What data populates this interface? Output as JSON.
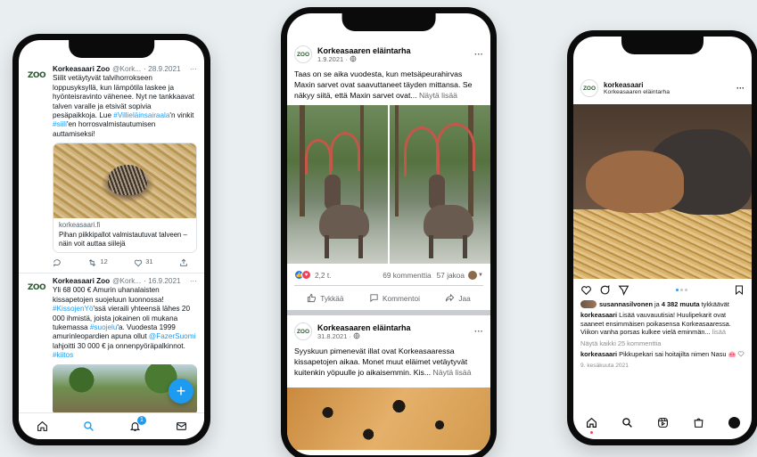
{
  "colors": {
    "background": "#e9eef1",
    "twitter_blue": "#1d9bf0",
    "facebook_gray": "#65676b",
    "instagram_blue": "#3897f0",
    "phone_frame": "#0b0b0b"
  },
  "logo_text": "ZOO",
  "twitter": {
    "tweets": [
      {
        "name": "Korkeasaari Zoo",
        "handle": "@Kork...",
        "date": "· 28.9.2021",
        "more": "···",
        "text_parts": [
          {
            "t": "Siilit vetäytyvät talvihorrokseen loppusyksyllä, kun lämpötila laskee ja hyönteisravinto vähenee. Nyt ne tankkaavat talven varalle ja etsivät sopivia pesäpaikkoja. Lue ",
            "tag": false
          },
          {
            "t": "#Villieläinsairaala",
            "tag": true
          },
          {
            "t": "'n vinkit ",
            "tag": false
          },
          {
            "t": "#siili",
            "tag": true
          },
          {
            "t": "'en horrosvalmistautumisen auttamiseksi!",
            "tag": false
          }
        ],
        "card": {
          "domain": "korkeasaari.fi",
          "title": "Pihan piikkipallot valmistautuvat talveen – näin voit auttaa siilejä"
        },
        "actions": {
          "reply": "",
          "retweets": "12",
          "likes": "31"
        }
      },
      {
        "name": "Korkeasaari Zoo",
        "handle": "@Kork...",
        "date": "· 16.9.2021",
        "more": "···",
        "text_parts": [
          {
            "t": "Yli 68 000 € Amurin uhanalaisten kissapetojen suojeluun luonnossa! ",
            "tag": false
          },
          {
            "t": "#KissojenYö",
            "tag": true
          },
          {
            "t": "'ssä vieraili yhteensä lähes 20 000 ihmistä, joista jokainen oli mukana tukemassa ",
            "tag": false
          },
          {
            "t": "#suojelu",
            "tag": true
          },
          {
            "t": "'a. Vuodesta 1999 amurinleopardien apuna ollut ",
            "tag": false
          },
          {
            "t": "@FazerSuomi",
            "tag": true
          },
          {
            "t": " lahjoitti 30 000 € ja onnenpyöräpalkinnot. ",
            "tag": false
          },
          {
            "t": "#kiitos",
            "tag": true
          }
        ]
      }
    ],
    "fab_label": "+",
    "notif_count": "1",
    "tabs": [
      "home-icon",
      "search-icon",
      "bell-icon",
      "mail-icon"
    ]
  },
  "facebook": {
    "post1": {
      "page": "Korkeasaaren eläintarha",
      "date": "1.9.2021 ·",
      "more": "···",
      "text": "Taas on se aika vuodesta, kun metsäpeurahirvas Maxin sarvet ovat saavuttaneet täyden mittansa. Se näkyy siitä, että Maxin sarvet ovat...",
      "see_more": "Näytä lisää",
      "reactions_count": "2,2 t.",
      "comments": "69 kommenttia",
      "shares": "57 jakoa",
      "actions": {
        "like": "Tykkää",
        "comment": "Kommentoi",
        "share": "Jaa"
      }
    },
    "post2": {
      "page": "Korkeasaaren eläintarha",
      "date": "31.8.2021 ·",
      "more": "···",
      "text": "Syyskuun pimenevät illat ovat Korkeasaaressa kissapetojen aikaa. Monet muut eläimet vetäytyvät kuitenkin yöpuulle jo aikaisemmin. Kis...",
      "see_more": "Näytä lisää"
    }
  },
  "instagram": {
    "username": "korkeasaari",
    "subtitle": "Korkeasaaren eläintarha",
    "more": "···",
    "carousel": {
      "count": 3,
      "active": 0
    },
    "liked_by_user": "susannasilvonen",
    "liked_by_rest": " ja ",
    "liked_by_count": "4 382 muuta",
    "liked_by_suffix": " tykkäävät",
    "caption_user": "korkeasaari",
    "caption": " Lisää vauvauutisia! Huulipekarit ovat saaneet ensimmäisen poikasensa Korkeasaaressa. Viikon vanha porsas kulkee vielä eminmän...",
    "caption_more": " lisää",
    "comments_link": "Näytä kaikki 25 kommenttia",
    "comment_user": "korkeasaari",
    "comment_text": " Pikkupekari sai hoitajilta nimen Nasu",
    "comment_emoji": "🐽",
    "date": "9. kesäkuuta 2021"
  }
}
